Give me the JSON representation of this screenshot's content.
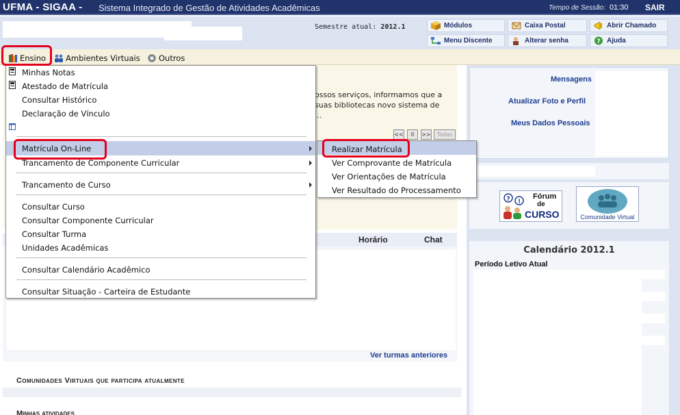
{
  "topbar": {
    "brand": "UFMA - SIGAA -",
    "system": "Sistema Integrado de Gestão de Atividades Acadêmicas",
    "session_label": "Tempo de Sessão:",
    "session_time": "01:30",
    "logout": "SAIR"
  },
  "header": {
    "semestre_label": "Semestre atual:",
    "semestre_value": "2012.1",
    "quick_buttons": {
      "modulos": "Módulos",
      "caixa_postal": "Caixa Postal",
      "abrir_chamado": "Abrir Chamado",
      "menu_discente": "Menu Discente",
      "alterar_senha": "Alterar senha",
      "ajuda": "Ajuda"
    }
  },
  "menubar": {
    "ensino": "Ensino",
    "ambientes": "Ambientes Virtuais",
    "outros": "Outros"
  },
  "dropdown": {
    "minhas_notas": "Minhas Notas",
    "atestado": "Atestado de Matrícula",
    "historico": "Consultar Histórico",
    "declaracao": "Declaração de Vínculo",
    "matricula_online": "Matrícula On-Line",
    "trancamento_componente": "Trancamento de Componente Curricular",
    "trancamento_curso": "Trancamento de Curso",
    "consultar_curso": "Consultar Curso",
    "consultar_componente": "Consultar Componente Curricular",
    "consultar_turma": "Consultar Turma",
    "unidades": "Unidades Acadêmicas",
    "calendario": "Consultar Calendário Acadêmico",
    "situacao_carteira": "Consultar Situação - Carteira de Estudante"
  },
  "submenu": {
    "realizar": "Realizar Matrícula",
    "comprovante": "Ver Comprovante de Matrícula",
    "orientacoes": "Ver Orientações de Matrícula",
    "resultado": "Ver Resultado do Processamento"
  },
  "notice": {
    "line1": "ossos serviços, informamos que a",
    "line2": "suas bibliotecas novo sistema de",
    "line3": "..."
  },
  "pager": {
    "first": "<<",
    "pause": "II",
    "next": ">>",
    "all": "Todas"
  },
  "table": {
    "horario": "Horário",
    "chat": "Chat"
  },
  "links": {
    "ver_turmas": "Ver turmas anteriores"
  },
  "sections": {
    "comunidades": "Comunidades Virtuais que participa atualmente",
    "minhas_atividades": "Minhas atividades"
  },
  "right": {
    "mensagens": "Mensagens",
    "atualizar_foto": "Atualizar Foto e Perfil",
    "meus_dados": "Meus Dados Pessoais",
    "forum_l1": "Fórum",
    "forum_l2": "de",
    "forum_l3": "CURSO",
    "comunidade_virtual": "Comunidade Virtual",
    "calendario_title": "Calendário 2012.1",
    "periodo": "Período Letivo Atual"
  },
  "colors": {
    "topbar": "#20336b",
    "highlight": "#c2cde8",
    "annotation_red": "#e3001b",
    "link_blue": "#1e3c8f"
  }
}
